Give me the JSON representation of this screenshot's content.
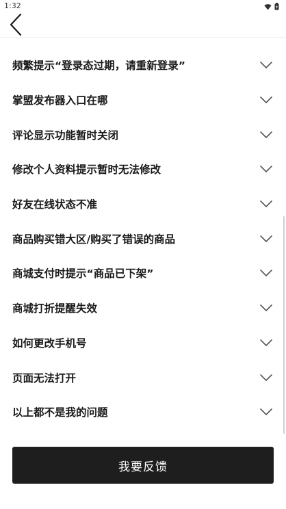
{
  "status_bar": {
    "time": "1:32",
    "icons": [
      "wifi-icon",
      "battery-icon"
    ]
  },
  "nav": {
    "back_icon": "chevron-left-icon"
  },
  "faq": {
    "items": [
      {
        "label": "频繁提示“登录态过期，请重新登录”"
      },
      {
        "label": "掌盟发布器入口在哪"
      },
      {
        "label": "评论显示功能暂时关闭"
      },
      {
        "label": "修改个人资料提示暂时无法修改"
      },
      {
        "label": "好友在线状态不准"
      },
      {
        "label": "商品购买错大区/购买了错误的商品"
      },
      {
        "label": "商城支付时提示“商品已下架”"
      },
      {
        "label": "商城打折提醒失效"
      },
      {
        "label": "如何更改手机号"
      },
      {
        "label": "页面无法打开"
      },
      {
        "label": "以上都不是我的问题"
      }
    ],
    "expand_icon": "chevron-down-icon"
  },
  "footer": {
    "feedback_label": "我要反馈"
  },
  "colors": {
    "button_bg": "#1e1e1e",
    "text": "#1a1a1a",
    "chevron": "#555555"
  }
}
